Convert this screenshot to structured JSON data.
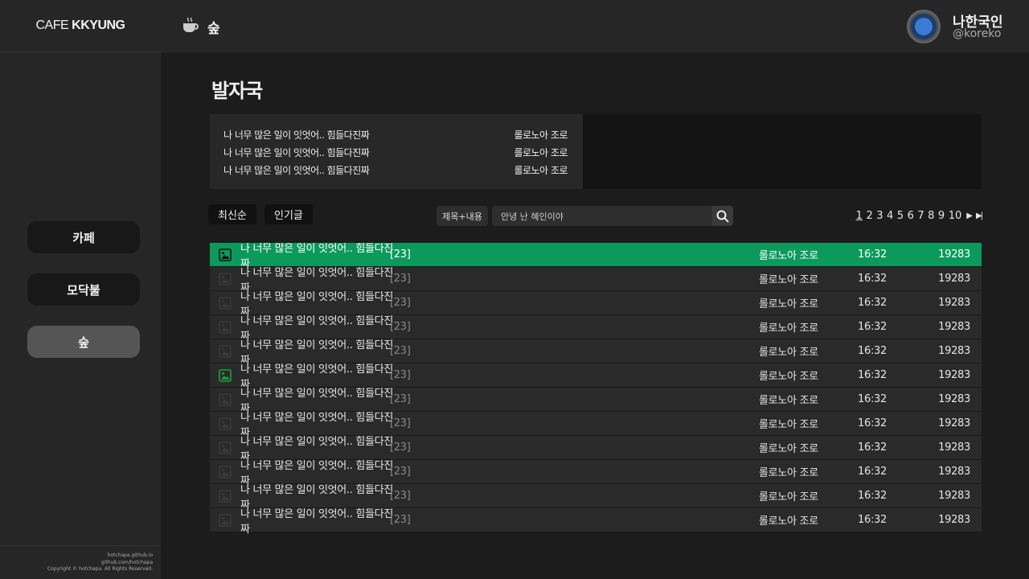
{
  "brand": {
    "light": "CAFE",
    "bold": "KKYUNG"
  },
  "header": {
    "category": "숲",
    "user_name": "나한국인",
    "user_id": "@koreko"
  },
  "sidebar": {
    "items": [
      {
        "label": "카페",
        "active": false
      },
      {
        "label": "모닥불",
        "active": false
      },
      {
        "label": "숲",
        "active": true
      }
    ],
    "footer": [
      "hotchapa.github.io",
      "github.com/hotchapa",
      "Copyright © hotchapa. All Rights Reserved."
    ]
  },
  "main": {
    "title": "발자국",
    "notices": [
      {
        "title": "나 너무 많은 일이 잇엇어.. 힘들다진짜",
        "author": "롤로노아 조로"
      },
      {
        "title": "나 너무 많은 일이 잇엇어.. 힘들다진짜",
        "author": "롤로노아 조로"
      },
      {
        "title": "나 너무 많은 일이 잇엇어.. 힘들다진짜",
        "author": "롤로노아 조로"
      }
    ],
    "sort": {
      "latest": "최신순",
      "popular": "인기글"
    },
    "search": {
      "type": "제목+내용",
      "value": "안녕 난 혜인이야"
    },
    "pages": [
      "1",
      "2",
      "3",
      "4",
      "5",
      "6",
      "7",
      "8",
      "9",
      "10"
    ],
    "posts": [
      {
        "title": "나 너무 많은 일이 잇엇어.. 힘들다진짜",
        "comments": "[23]",
        "author": "롤로노아 조로",
        "time": "16:32",
        "views": "19283",
        "has_image": true,
        "highlight": true
      },
      {
        "title": "나 너무 많은 일이 잇엇어.. 힘들다진짜",
        "comments": "[23]",
        "author": "롤로노아 조로",
        "time": "16:32",
        "views": "19283",
        "has_image": false,
        "highlight": false
      },
      {
        "title": "나 너무 많은 일이 잇엇어.. 힘들다진짜",
        "comments": "[23]",
        "author": "롤로노아 조로",
        "time": "16:32",
        "views": "19283",
        "has_image": false,
        "highlight": false
      },
      {
        "title": "나 너무 많은 일이 잇엇어.. 힘들다진짜",
        "comments": "[23]",
        "author": "롤로노아 조로",
        "time": "16:32",
        "views": "19283",
        "has_image": false,
        "highlight": false
      },
      {
        "title": "나 너무 많은 일이 잇엇어.. 힘들다진짜",
        "comments": "[23]",
        "author": "롤로노아 조로",
        "time": "16:32",
        "views": "19283",
        "has_image": false,
        "highlight": false
      },
      {
        "title": "나 너무 많은 일이 잇엇어.. 힘들다진짜",
        "comments": "[23]",
        "author": "롤로노아 조로",
        "time": "16:32",
        "views": "19283",
        "has_image": true,
        "highlight": false
      },
      {
        "title": "나 너무 많은 일이 잇엇어.. 힘들다진짜",
        "comments": "[23]",
        "author": "롤로노아 조로",
        "time": "16:32",
        "views": "19283",
        "has_image": false,
        "highlight": false
      },
      {
        "title": "나 너무 많은 일이 잇엇어.. 힘들다진짜",
        "comments": "[23]",
        "author": "롤로노아 조로",
        "time": "16:32",
        "views": "19283",
        "has_image": false,
        "highlight": false
      },
      {
        "title": "나 너무 많은 일이 잇엇어.. 힘들다진짜",
        "comments": "[23]",
        "author": "롤로노아 조로",
        "time": "16:32",
        "views": "19283",
        "has_image": false,
        "highlight": false
      },
      {
        "title": "나 너무 많은 일이 잇엇어.. 힘들다진짜",
        "comments": "[23]",
        "author": "롤로노아 조로",
        "time": "16:32",
        "views": "19283",
        "has_image": false,
        "highlight": false
      },
      {
        "title": "나 너무 많은 일이 잇엇어.. 힘들다진짜",
        "comments": "[23]",
        "author": "롤로노아 조로",
        "time": "16:32",
        "views": "19283",
        "has_image": false,
        "highlight": false
      },
      {
        "title": "나 너무 많은 일이 잇엇어.. 힘들다진짜",
        "comments": "[23]",
        "author": "롤로노아 조로",
        "time": "16:32",
        "views": "19283",
        "has_image": false,
        "highlight": false
      }
    ]
  },
  "colors": {
    "accent": "#0b9a5c",
    "image_icon_active": "#1aa33a"
  }
}
